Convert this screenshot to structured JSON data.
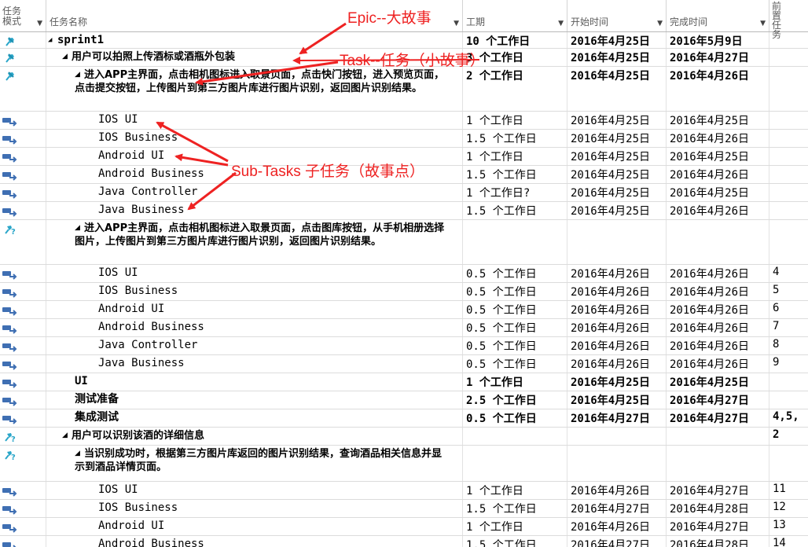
{
  "columns": {
    "mode": "任务模式",
    "name": "任务名称",
    "duration": "工期",
    "start": "开始时间",
    "finish": "完成时间",
    "predecessors": "前置任务"
  },
  "rows": [
    {
      "mode": "manual-pin",
      "level": 0,
      "collapse": true,
      "bold": true,
      "name": "sprint1",
      "duration": "10 个工作日",
      "start": "2016年4月25日",
      "finish": "2016年5月9日",
      "pred": ""
    },
    {
      "mode": "manual-pin",
      "level": 1,
      "collapse": true,
      "bold": true,
      "name": "用户可以拍照上传酒标或酒瓶外包装",
      "duration": "3 个工作日",
      "start": "2016年4月25日",
      "finish": "2016年4月27日",
      "pred": ""
    },
    {
      "mode": "manual-pin",
      "level": 2,
      "collapse": true,
      "bold": true,
      "name": "进入APP主界面，点击相机图标进入取景页面，点击快门按钮，进入预览页面，点击提交按钮，上传图片到第三方图片库进行图片识别，返回图片识别结果。",
      "duration": "2 个工作日",
      "start": "2016年4月25日",
      "finish": "2016年4月26日",
      "pred": ""
    },
    {
      "mode": "auto",
      "level": 3,
      "bold": false,
      "name": "IOS UI",
      "duration": "1 个工作日",
      "start": "2016年4月25日",
      "finish": "2016年4月25日",
      "pred": ""
    },
    {
      "mode": "auto",
      "level": 3,
      "bold": false,
      "name": "IOS Business",
      "duration": "1.5 个工作日",
      "start": "2016年4月25日",
      "finish": "2016年4月26日",
      "pred": ""
    },
    {
      "mode": "auto",
      "level": 3,
      "bold": false,
      "name": "Android UI",
      "duration": "1 个工作日",
      "start": "2016年4月25日",
      "finish": "2016年4月25日",
      "pred": ""
    },
    {
      "mode": "auto",
      "level": 3,
      "bold": false,
      "name": "Android Business",
      "duration": "1.5 个工作日",
      "start": "2016年4月25日",
      "finish": "2016年4月26日",
      "pred": ""
    },
    {
      "mode": "auto",
      "level": 3,
      "bold": false,
      "name": "Java Controller",
      "duration": "1 个工作日?",
      "start": "2016年4月25日",
      "finish": "2016年4月25日",
      "pred": ""
    },
    {
      "mode": "auto",
      "level": 3,
      "bold": false,
      "name": "Java Business",
      "duration": "1.5 个工作日",
      "start": "2016年4月25日",
      "finish": "2016年4月26日",
      "pred": ""
    },
    {
      "mode": "manual-question",
      "level": 2,
      "collapse": true,
      "bold": true,
      "name": "进入APP主界面，点击相机图标进入取景页面，点击图库按钮，从手机相册选择图片，上传图片到第三方图片库进行图片识别，返回图片识别结果。",
      "duration": "",
      "start": "",
      "finish": "",
      "pred": ""
    },
    {
      "mode": "auto",
      "level": 3,
      "bold": false,
      "name": "IOS UI",
      "duration": "0.5 个工作日",
      "start": "2016年4月26日",
      "finish": "2016年4月26日",
      "pred": "4"
    },
    {
      "mode": "auto",
      "level": 3,
      "bold": false,
      "name": "IOS Business",
      "duration": "0.5 个工作日",
      "start": "2016年4月26日",
      "finish": "2016年4月26日",
      "pred": "5"
    },
    {
      "mode": "auto",
      "level": 3,
      "bold": false,
      "name": "Android UI",
      "duration": "0.5 个工作日",
      "start": "2016年4月26日",
      "finish": "2016年4月26日",
      "pred": "6"
    },
    {
      "mode": "auto",
      "level": 3,
      "bold": false,
      "name": "Android Business",
      "duration": "0.5 个工作日",
      "start": "2016年4月26日",
      "finish": "2016年4月26日",
      "pred": "7"
    },
    {
      "mode": "auto",
      "level": 3,
      "bold": false,
      "name": "Java Controller",
      "duration": "0.5 个工作日",
      "start": "2016年4月26日",
      "finish": "2016年4月26日",
      "pred": "8"
    },
    {
      "mode": "auto",
      "level": 3,
      "bold": false,
      "name": "Java Business",
      "duration": "0.5 个工作日",
      "start": "2016年4月26日",
      "finish": "2016年4月26日",
      "pred": "9"
    },
    {
      "mode": "auto",
      "level": 2,
      "bold": true,
      "name": "UI",
      "duration": "1 个工作日",
      "start": "2016年4月25日",
      "finish": "2016年4月25日",
      "pred": ""
    },
    {
      "mode": "auto",
      "level": 2,
      "bold": true,
      "name": "测试准备",
      "duration": "2.5 个工作日",
      "start": "2016年4月25日",
      "finish": "2016年4月27日",
      "pred": ""
    },
    {
      "mode": "auto",
      "level": 2,
      "bold": true,
      "name": "集成测试",
      "duration": "0.5 个工作日",
      "start": "2016年4月27日",
      "finish": "2016年4月27日",
      "pred": "4,5,"
    },
    {
      "mode": "manual-question",
      "level": 1,
      "collapse": true,
      "bold": true,
      "name": "用户可以识别该酒的详细信息",
      "duration": "",
      "start": "",
      "finish": "",
      "pred": "2"
    },
    {
      "mode": "manual-question",
      "level": 2,
      "collapse": true,
      "bold": true,
      "name": "当识别成功时，根据第三方图片库返回的图片识别结果，查询酒品相关信息并显示到酒品详情页面。",
      "duration": "",
      "start": "",
      "finish": "",
      "pred": ""
    },
    {
      "mode": "auto",
      "level": 3,
      "bold": false,
      "name": "IOS UI",
      "duration": "1 个工作日",
      "start": "2016年4月26日",
      "finish": "2016年4月27日",
      "pred": "11"
    },
    {
      "mode": "auto",
      "level": 3,
      "bold": false,
      "name": "IOS Business",
      "duration": "1.5 个工作日",
      "start": "2016年4月27日",
      "finish": "2016年4月28日",
      "pred": "12"
    },
    {
      "mode": "auto",
      "level": 3,
      "bold": false,
      "name": "Android UI",
      "duration": "1 个工作日",
      "start": "2016年4月26日",
      "finish": "2016年4月27日",
      "pred": "13"
    },
    {
      "mode": "auto",
      "level": 3,
      "bold": false,
      "name": "Android Business",
      "duration": "1.5 个工作日",
      "start": "2016年4月27日",
      "finish": "2016年4月28日",
      "pred": "14"
    }
  ],
  "annotations": {
    "epic": "Epic--大故事",
    "task": "Task--任务（小故事）",
    "subtasks": "Sub-Tasks 子任务（故事点）"
  },
  "colors": {
    "annotation": "#ee2222",
    "pin_icon": "#2aa6c9",
    "auto_icon": "#3f6fb3"
  }
}
